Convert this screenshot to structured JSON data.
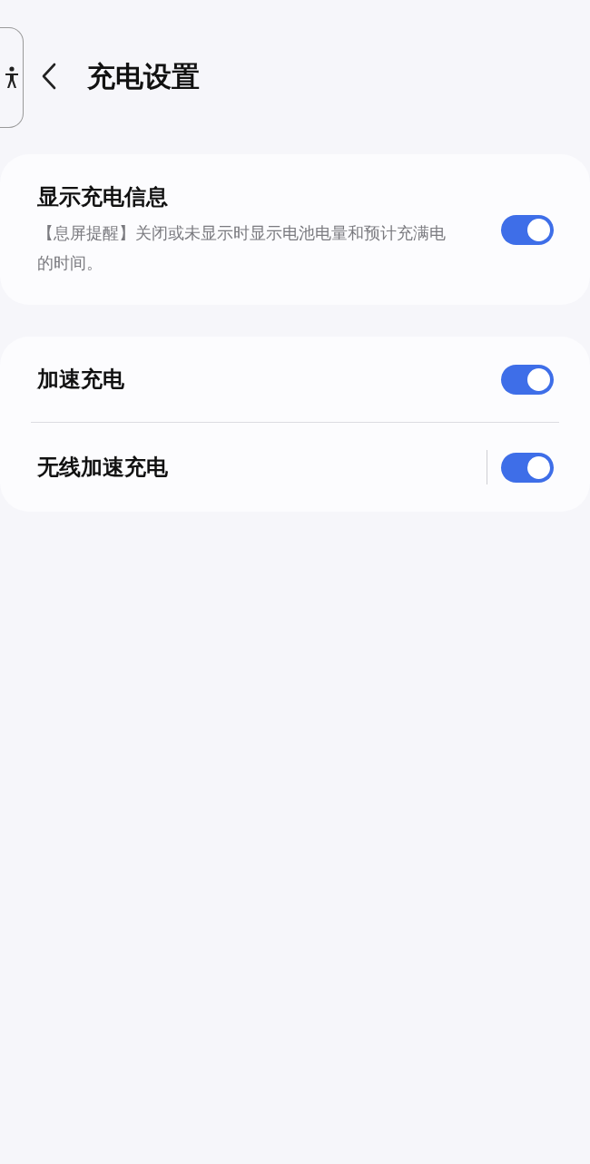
{
  "header": {
    "title": "充电设置"
  },
  "sections": [
    {
      "items": [
        {
          "title": "显示充电信息",
          "description": "【息屏提醒】关闭或未显示时显示电池电量和预计充满电的时间。",
          "on": true,
          "separator": false
        }
      ]
    },
    {
      "items": [
        {
          "title": "加速充电",
          "on": true,
          "separator": false
        },
        {
          "title": "无线加速充电",
          "on": true,
          "separator": true
        }
      ]
    }
  ]
}
